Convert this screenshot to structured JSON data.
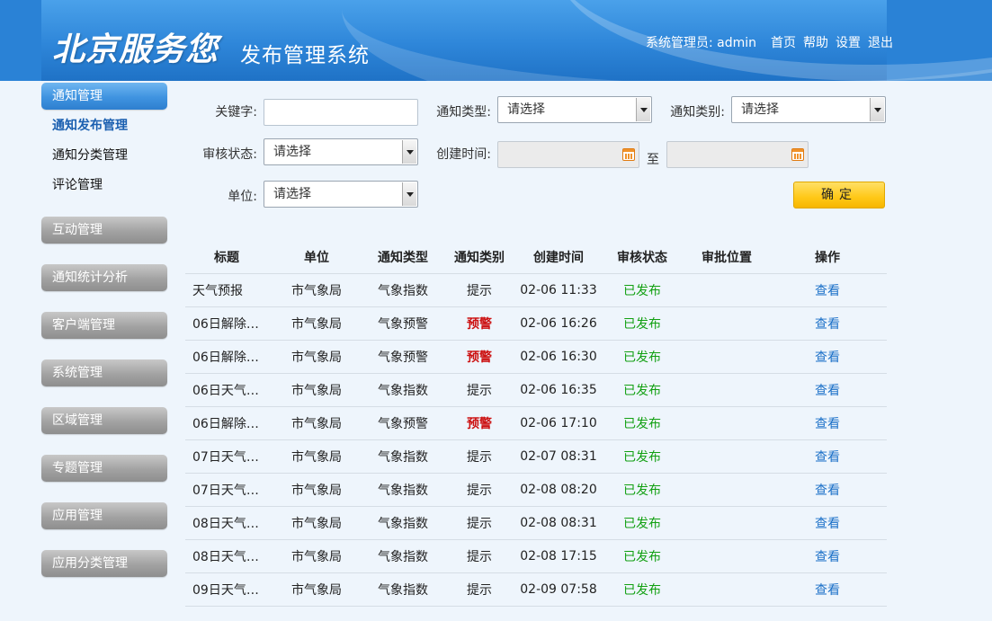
{
  "header": {
    "logo_main": "北京服务您",
    "logo_sub": "发布管理系统",
    "user": "系统管理员: admin",
    "links": [
      "首页",
      "帮助",
      "设置",
      "退出"
    ],
    "colors": {
      "header_blue": "#2e86d9",
      "accent_yellow": "#ffc817",
      "status_green": "#12a012",
      "warn_red": "#cc1111",
      "link_blue": "#1b70c8"
    }
  },
  "sidebar": {
    "active_group": "通知管理",
    "sub_items": [
      "通知发布管理",
      "通知分类管理",
      "评论管理"
    ],
    "groups": [
      "互动管理",
      "通知统计分析",
      "客户端管理",
      "系统管理",
      "区域管理",
      "专题管理",
      "应用管理",
      "应用分类管理"
    ]
  },
  "filters": {
    "keyword_label": "关键字:",
    "keyword_value": "",
    "type_label": "通知类型:",
    "type_value": "请选择",
    "category_label": "通知类别:",
    "category_value": "请选择",
    "status_label": "审核状态:",
    "status_value": "请选择",
    "created_label": "创建时间:",
    "to_label": "至",
    "unit_label": "单位:",
    "unit_value": "请选择",
    "confirm_label": "确定"
  },
  "table": {
    "headers": [
      "标题",
      "单位",
      "通知类型",
      "通知类别",
      "创建时间",
      "审核状态",
      "审批位置",
      "操作"
    ],
    "rows": [
      {
        "title": "天气预报",
        "unit": "市气象局",
        "type": "气象指数",
        "category": "提示",
        "time": "02-06 11:33",
        "status": "已发布",
        "location": "",
        "op": "查看",
        "warn": false
      },
      {
        "title": "06日解除…",
        "unit": "市气象局",
        "type": "气象预警",
        "category": "预警",
        "time": "02-06 16:26",
        "status": "已发布",
        "location": "",
        "op": "查看",
        "warn": true
      },
      {
        "title": "06日解除…",
        "unit": "市气象局",
        "type": "气象预警",
        "category": "预警",
        "time": "02-06 16:30",
        "status": "已发布",
        "location": "",
        "op": "查看",
        "warn": true
      },
      {
        "title": "06日天气…",
        "unit": "市气象局",
        "type": "气象指数",
        "category": "提示",
        "time": "02-06 16:35",
        "status": "已发布",
        "location": "",
        "op": "查看",
        "warn": false
      },
      {
        "title": "06日解除…",
        "unit": "市气象局",
        "type": "气象预警",
        "category": "预警",
        "time": "02-06 17:10",
        "status": "已发布",
        "location": "",
        "op": "查看",
        "warn": true
      },
      {
        "title": "07日天气…",
        "unit": "市气象局",
        "type": "气象指数",
        "category": "提示",
        "time": "02-07 08:31",
        "status": "已发布",
        "location": "",
        "op": "查看",
        "warn": false
      },
      {
        "title": "07日天气…",
        "unit": "市气象局",
        "type": "气象指数",
        "category": "提示",
        "time": "02-08 08:20",
        "status": "已发布",
        "location": "",
        "op": "查看",
        "warn": false
      },
      {
        "title": "08日天气…",
        "unit": "市气象局",
        "type": "气象指数",
        "category": "提示",
        "time": "02-08 08:31",
        "status": "已发布",
        "location": "",
        "op": "查看",
        "warn": false
      },
      {
        "title": "08日天气…",
        "unit": "市气象局",
        "type": "气象指数",
        "category": "提示",
        "time": "02-08 17:15",
        "status": "已发布",
        "location": "",
        "op": "查看",
        "warn": false
      },
      {
        "title": "09日天气…",
        "unit": "市气象局",
        "type": "气象指数",
        "category": "提示",
        "time": "02-09 07:58",
        "status": "已发布",
        "location": "",
        "op": "查看",
        "warn": false
      }
    ]
  }
}
